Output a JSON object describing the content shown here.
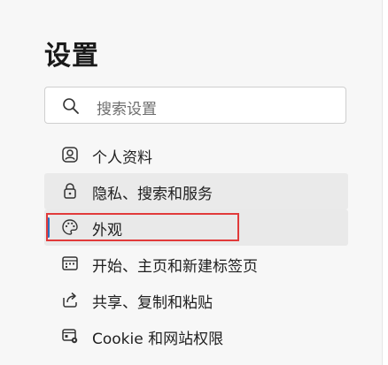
{
  "settings": {
    "title": "设置",
    "search": {
      "placeholder": "搜索设置",
      "icon": "search-icon"
    },
    "nav": [
      {
        "label": "个人资料",
        "icon": "profile-icon",
        "state": "normal"
      },
      {
        "label": "隐私、搜索和服务",
        "icon": "lock-icon",
        "state": "hover"
      },
      {
        "label": "外观",
        "icon": "palette-icon",
        "state": "selected"
      },
      {
        "label": "开始、主页和新建标签页",
        "icon": "home-page-icon",
        "state": "normal"
      },
      {
        "label": "共享、复制和粘贴",
        "icon": "share-icon",
        "state": "normal"
      },
      {
        "label": "Cookie 和网站权限",
        "icon": "site-permissions-icon",
        "state": "normal"
      }
    ],
    "colors": {
      "accent": "#2f6fbd",
      "highlight_border": "#e13a3a",
      "panel_bg": "#f7f7f7"
    }
  }
}
